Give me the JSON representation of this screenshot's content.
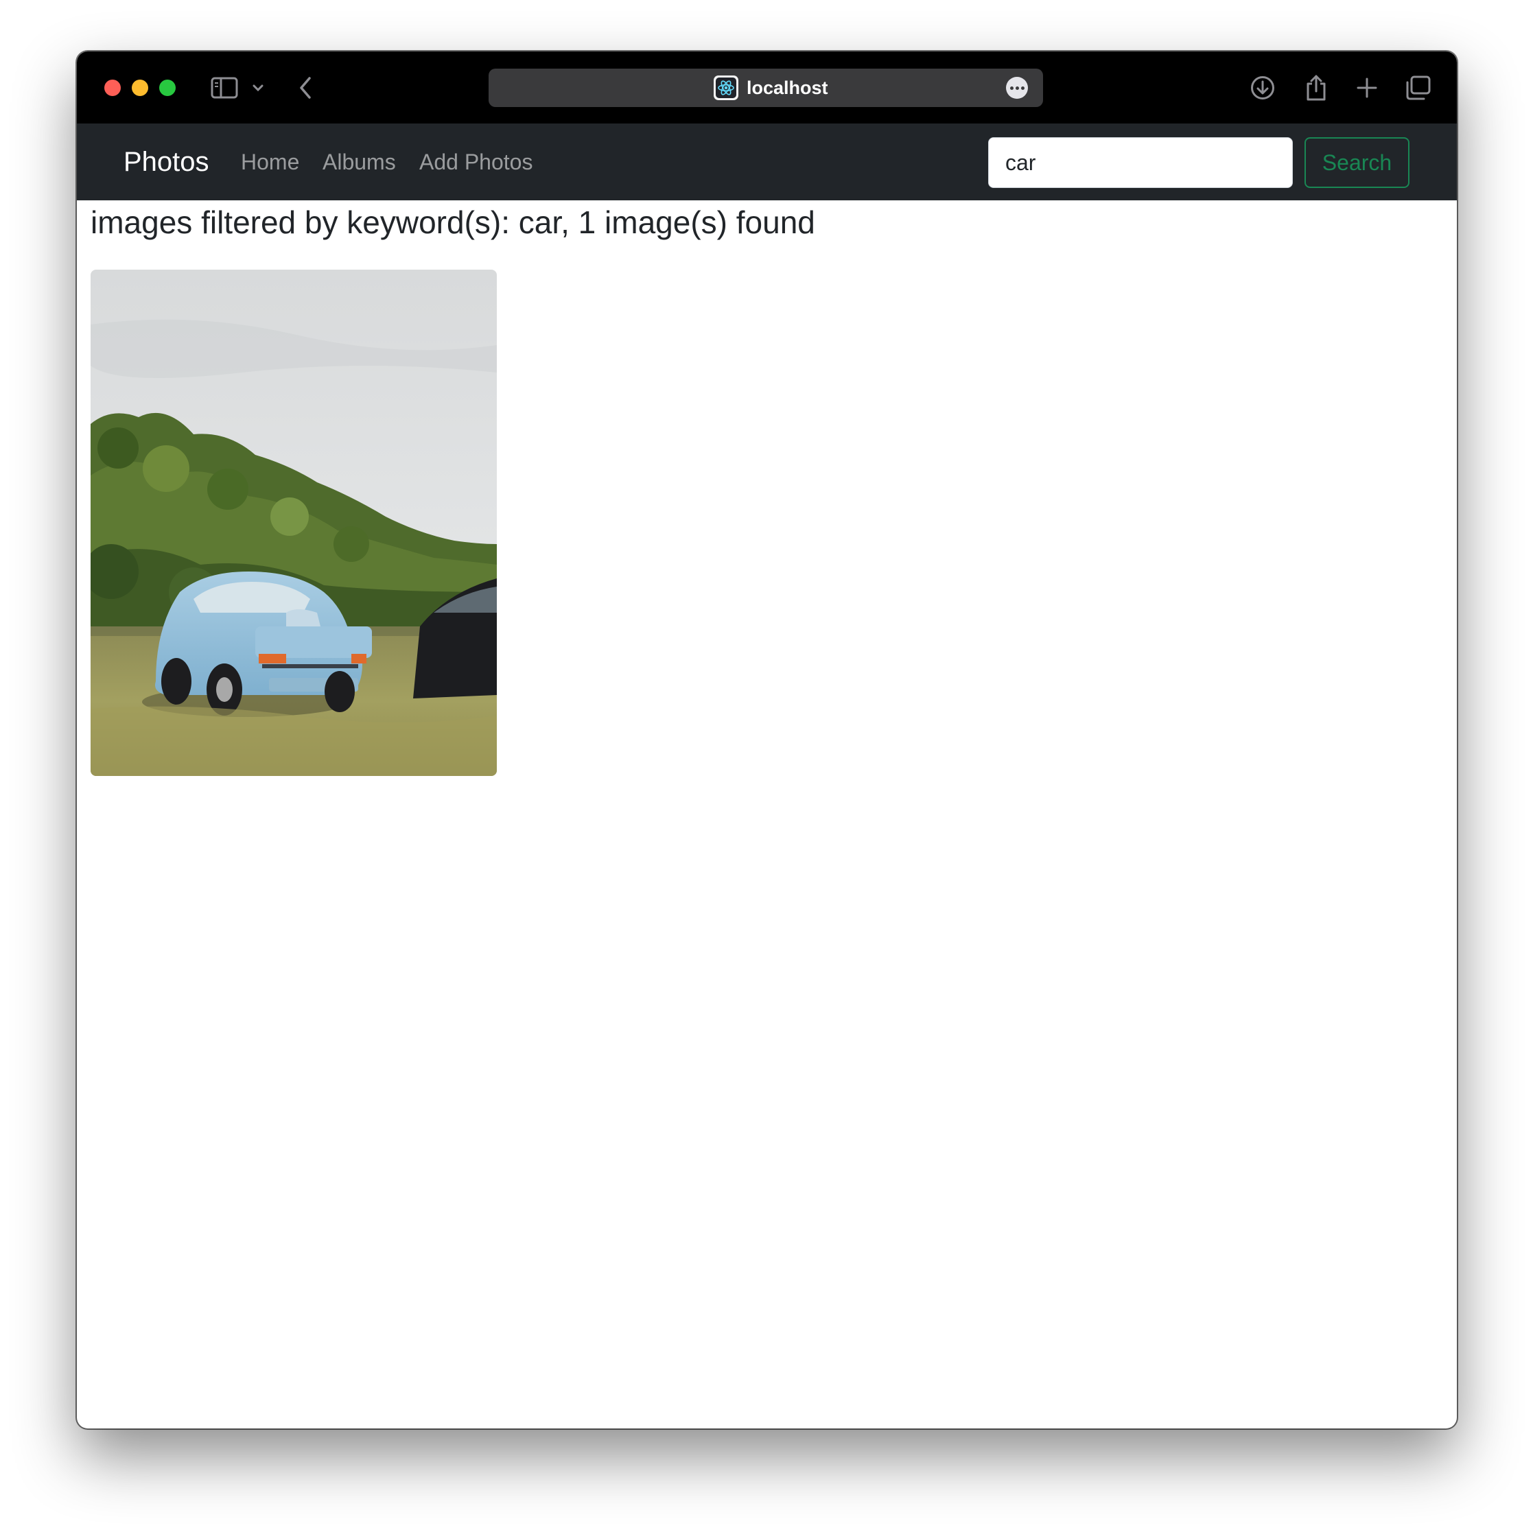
{
  "browser": {
    "url": "localhost",
    "icons": {
      "sidebar": "sidebar-toggle-icon",
      "chevron": "chevron-down-icon",
      "back": "back-arrow-icon",
      "favicon": "react-atom-icon",
      "more": "ellipsis-circle-icon",
      "download": "download-icon",
      "share": "share-icon",
      "new_tab": "plus-icon",
      "tabs": "tab-overview-icon"
    }
  },
  "navbar": {
    "brand": "Photos",
    "links": [
      "Home",
      "Albums",
      "Add Photos"
    ],
    "search": {
      "value": "car",
      "button_label": "Search"
    }
  },
  "main": {
    "heading": "images filtered by keyword(s): car, 1 image(s) found",
    "images": [
      {
        "alt": "Light blue classic car parked on grass in front of a wooded hill"
      }
    ]
  },
  "colors": {
    "navbar_bg": "#212529",
    "search_button": "#198754",
    "titlebar_bg": "#000000"
  }
}
